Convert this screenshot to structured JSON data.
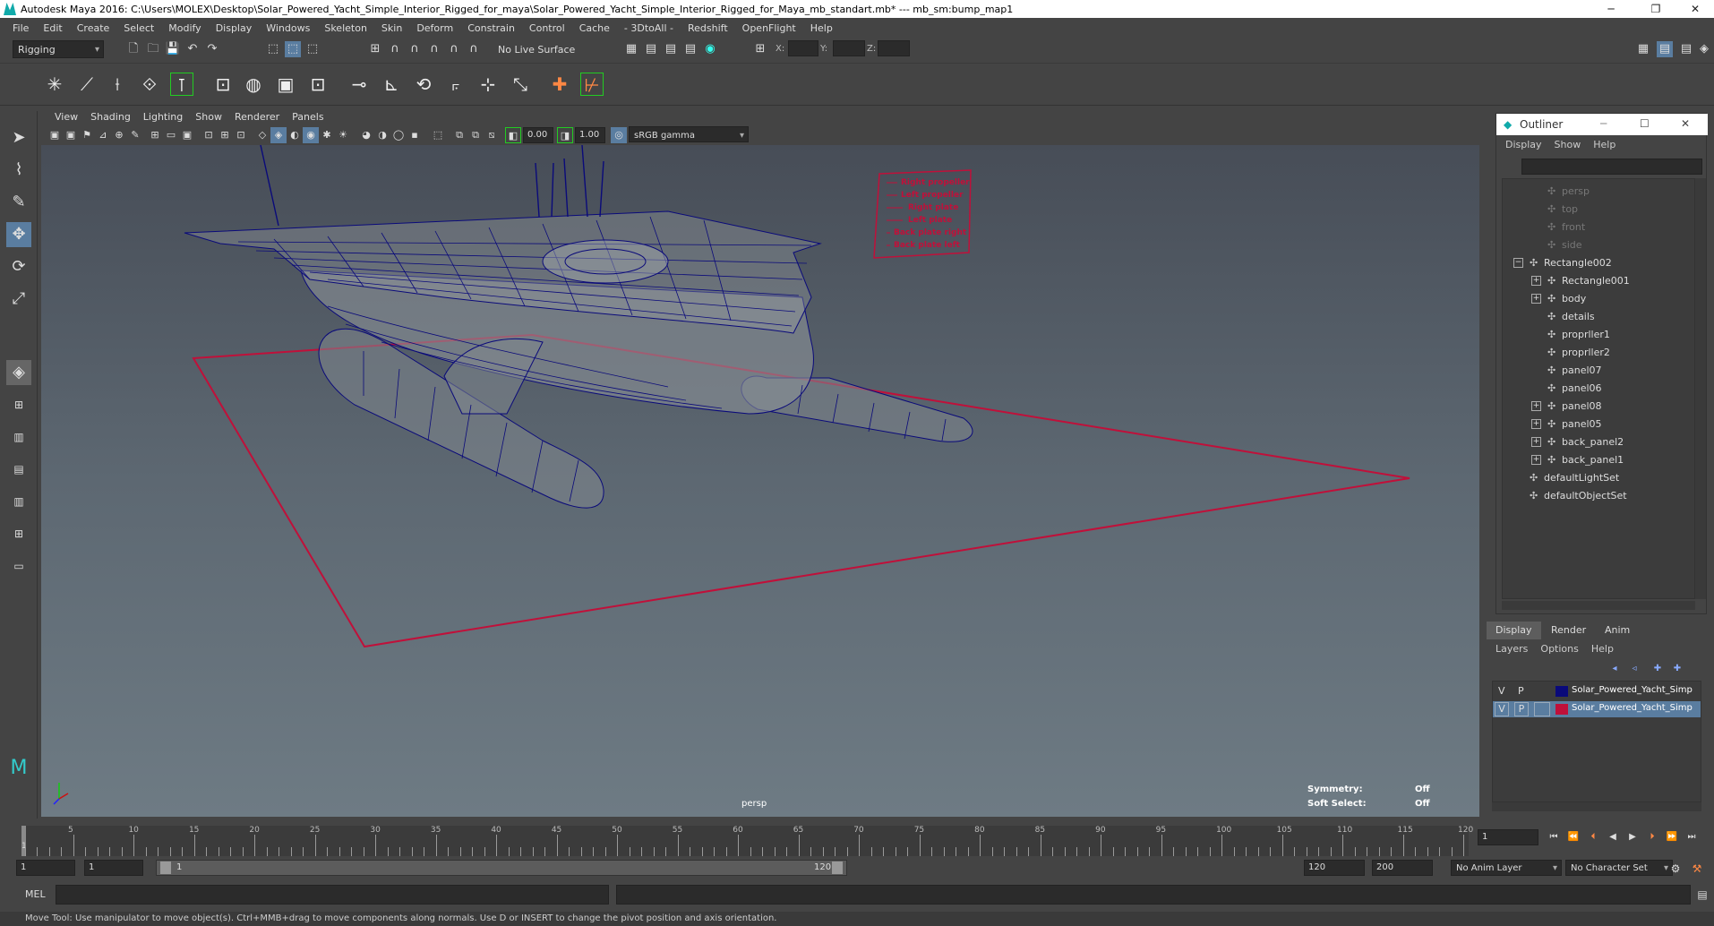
{
  "window": {
    "title": "Autodesk Maya 2016: C:\\Users\\MOLEX\\Desktop\\Solar_Powered_Yacht_Simple_Interior_Rigged_for_maya\\Solar_Powered_Yacht_Simple_Interior_Rigged_for_Maya_mb_standart.mb*  ---  mb_sm:bump_map1",
    "controls": {
      "minimize": "─",
      "restore": "❐",
      "close": "✕"
    }
  },
  "menubar": [
    "File",
    "Edit",
    "Create",
    "Select",
    "Modify",
    "Display",
    "Windows",
    "Skeleton",
    "Skin",
    "Deform",
    "Constrain",
    "Control",
    "Cache",
    "- 3DtoAll -",
    "Redshift",
    "OpenFlight",
    "Help"
  ],
  "statusline": {
    "mode": "Rigging",
    "live_surface": "No Live Surface",
    "x_label": "X:",
    "y_label": "Y:",
    "z_label": "Z:"
  },
  "viewport": {
    "menu": [
      "View",
      "Shading",
      "Lighting",
      "Show",
      "Renderer",
      "Panels"
    ],
    "exposure": "0.00",
    "gamma": "1.00",
    "color_space": "sRGB gamma",
    "camera": "persp",
    "symmetry_label": "Symmetry:",
    "symmetry_value": "Off",
    "soft_select_label": "Soft Select:",
    "soft_select_value": "Off",
    "controller_labels": [
      "Right propeller",
      "Left propeller",
      "Right plate",
      "Left plate",
      "Back plate right",
      "Back plate left"
    ],
    "colors": {
      "wire": "#0a0a7a",
      "selection": "#c0103a"
    }
  },
  "outliner": {
    "title": "Outliner",
    "menu": [
      "Display",
      "Show",
      "Help"
    ],
    "items": [
      {
        "label": "persp",
        "dim": true,
        "indent": 2,
        "expand": ""
      },
      {
        "label": "top",
        "dim": true,
        "indent": 2,
        "expand": ""
      },
      {
        "label": "front",
        "dim": true,
        "indent": 2,
        "expand": ""
      },
      {
        "label": "side",
        "dim": true,
        "indent": 2,
        "expand": ""
      },
      {
        "label": "Rectangle002",
        "dim": false,
        "indent": 1,
        "expand": "−"
      },
      {
        "label": "Rectangle001",
        "dim": false,
        "indent": 2,
        "expand": "+"
      },
      {
        "label": "body",
        "dim": false,
        "indent": 2,
        "expand": "+"
      },
      {
        "label": "details",
        "dim": false,
        "indent": 2,
        "expand": ""
      },
      {
        "label": "proprller1",
        "dim": false,
        "indent": 2,
        "expand": ""
      },
      {
        "label": "proprller2",
        "dim": false,
        "indent": 2,
        "expand": ""
      },
      {
        "label": "panel07",
        "dim": false,
        "indent": 2,
        "expand": ""
      },
      {
        "label": "panel06",
        "dim": false,
        "indent": 2,
        "expand": ""
      },
      {
        "label": "panel08",
        "dim": false,
        "indent": 2,
        "expand": "+"
      },
      {
        "label": "panel05",
        "dim": false,
        "indent": 2,
        "expand": "+"
      },
      {
        "label": "back_panel2",
        "dim": false,
        "indent": 2,
        "expand": "+"
      },
      {
        "label": "back_panel1",
        "dim": false,
        "indent": 2,
        "expand": "+"
      },
      {
        "label": "defaultLightSet",
        "dim": false,
        "indent": 1,
        "expand": ""
      },
      {
        "label": "defaultObjectSet",
        "dim": false,
        "indent": 1,
        "expand": ""
      }
    ]
  },
  "layer_editor": {
    "tabs": [
      "Display",
      "Render",
      "Anim"
    ],
    "menu": [
      "Layers",
      "Options",
      "Help"
    ],
    "layers": [
      {
        "v": "V",
        "p": "P",
        "name": "Solar_Powered_Yacht_Simp",
        "color": "#0a0a7a",
        "selected": false
      },
      {
        "v": "V",
        "p": "P",
        "name": "Solar_Powered_Yacht_Simp",
        "color": "#c0103a",
        "selected": true
      }
    ]
  },
  "timeline": {
    "ticks": [
      "5",
      "10",
      "15",
      "20",
      "25",
      "30",
      "35",
      "40",
      "45",
      "50",
      "55",
      "60",
      "65",
      "70",
      "75",
      "80",
      "85",
      "90",
      "95",
      "100",
      "105",
      "110",
      "115",
      "120"
    ],
    "first": "1",
    "current_frame": "1",
    "range_start": "1",
    "range_start2": "1",
    "range_slider_start": "1",
    "range_slider_end": "120",
    "range_end": "120",
    "anim_end": "200",
    "anim_layer": "No Anim Layer",
    "character_set": "No Character Set"
  },
  "command_line": {
    "label": "MEL"
  },
  "help_line": "Move Tool: Use manipulator to move object(s). Ctrl+MMB+drag to move components along normals. Use D or INSERT to change the pivot position and axis orientation."
}
